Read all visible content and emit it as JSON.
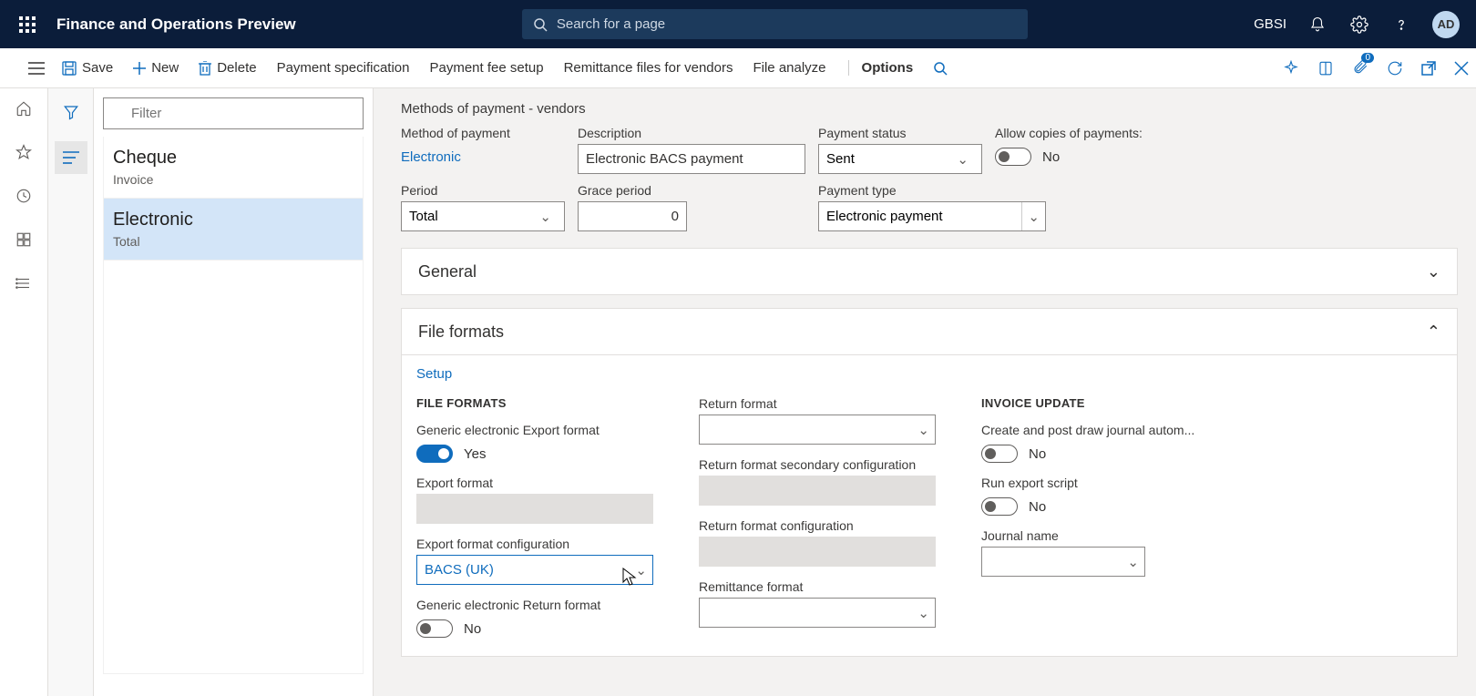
{
  "header": {
    "app_title": "Finance and Operations Preview",
    "search_placeholder": "Search for a page",
    "legal_entity": "GBSI",
    "avatar": "AD"
  },
  "actionbar": {
    "save": "Save",
    "new": "New",
    "delete": "Delete",
    "payment_specification": "Payment specification",
    "payment_fee_setup": "Payment fee setup",
    "remittance_files": "Remittance files for vendors",
    "file_analyze": "File analyze",
    "options": "Options",
    "attachment_count": "0"
  },
  "list": {
    "filter_placeholder": "Filter",
    "items": [
      {
        "title": "Cheque",
        "sub": "Invoice"
      },
      {
        "title": "Electronic",
        "sub": "Total"
      }
    ],
    "selected_index": 1
  },
  "page": {
    "title": "Methods of payment - vendors",
    "method_of_payment_label": "Method of payment",
    "method_of_payment_value": "Electronic",
    "description_label": "Description",
    "description_value": "Electronic BACS payment",
    "status_label": "Payment status",
    "status_value": "Sent",
    "allow_copies_label": "Allow copies of payments:",
    "allow_copies_value": "No",
    "period_label": "Period",
    "period_value": "Total",
    "grace_label": "Grace period",
    "grace_value": "0",
    "ptype_label": "Payment type",
    "ptype_value": "Electronic payment"
  },
  "fasttabs": {
    "general": "General",
    "file_formats": "File formats",
    "setup_link": "Setup"
  },
  "fileformats": {
    "section1": "FILE FORMATS",
    "generic_export_label": "Generic electronic Export format",
    "generic_export_value": "Yes",
    "export_format_label": "Export format",
    "export_config_label": "Export format configuration",
    "export_config_value": "BACS (UK)",
    "generic_return_label": "Generic electronic Return format",
    "generic_return_value": "No",
    "return_format_label": "Return format",
    "return_secondary_label": "Return format secondary configuration",
    "return_config_label": "Return format configuration",
    "remittance_label": "Remittance format",
    "section2": "INVOICE UPDATE",
    "create_post_label": "Create and post draw journal autom...",
    "create_post_value": "No",
    "run_script_label": "Run export script",
    "run_script_value": "No",
    "journal_label": "Journal name"
  }
}
